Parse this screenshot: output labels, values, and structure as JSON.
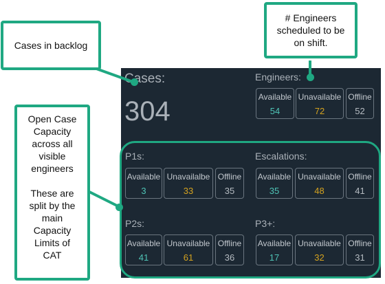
{
  "cases": {
    "title": "Cases:",
    "count": "304"
  },
  "engineers": {
    "title": "Engineers:",
    "available_label": "Available",
    "available": "54",
    "unavailable_label": "Unavailable",
    "unavailable": "72",
    "offline_label": "Offline",
    "offline": "52"
  },
  "p1s": {
    "title": "P1s:",
    "available_label": "Available",
    "available": "3",
    "unavailable_label": "Unavailalbe",
    "unavailable": "33",
    "offline_label": "Offline",
    "offline": "35"
  },
  "escalations": {
    "title": "Escalations:",
    "available_label": "Available",
    "available": "35",
    "unavailable_label": "Unavailable",
    "unavailable": "48",
    "offline_label": "Offline",
    "offline": "41"
  },
  "p2s": {
    "title": "P2s:",
    "available_label": "Available",
    "available": "41",
    "unavailable_label": "Unavailable",
    "unavailable": "61",
    "offline_label": "Offline",
    "offline": "36"
  },
  "p3plus": {
    "title": "P3+:",
    "available_label": "Available",
    "available": "17",
    "unavailable_label": "Unavailable",
    "unavailable": "32",
    "offline_label": "Offline",
    "offline": "31"
  },
  "callouts": {
    "backlog": "Cases in backlog",
    "engineers_line1": "# Engineers",
    "engineers_line2": "scheduled to be",
    "engineers_line3": "on shift.",
    "capacity_lines": [
      "Open Case",
      "Capacity",
      "across all",
      "visible",
      "engineers",
      "",
      "These are",
      "split by the",
      "main",
      "Capacity",
      "Limits of",
      "CAT"
    ]
  },
  "colors": {
    "available": "#4fc3b5",
    "unavailable": "#d4a21f",
    "offline": "#b6bcc2",
    "accent": "#1fa882",
    "panel": "#1c2833"
  }
}
